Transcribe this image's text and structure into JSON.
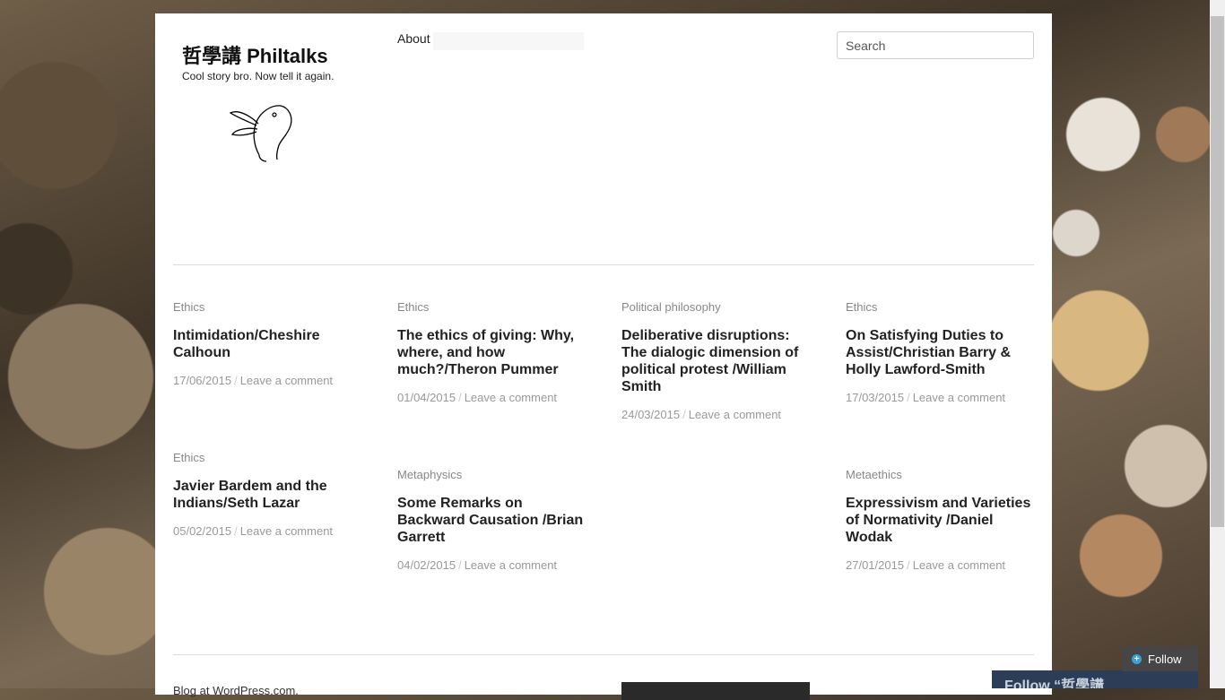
{
  "site": {
    "title": "哲學講 Philtalks",
    "description": "Cool story bro. Now tell it again.",
    "logo_icon": "rabbit-duck-icon"
  },
  "nav": {
    "about": "About"
  },
  "search": {
    "placeholder": "Search"
  },
  "posts": [
    {
      "category": "Ethics",
      "title": "Intimidation/Cheshire Calhoun",
      "date": "17/06/2015",
      "comments": "Leave a comment"
    },
    {
      "category": "Ethics",
      "title": "The ethics of giving: Why, where, and how much?/Theron Pummer",
      "date": "01/04/2015",
      "comments": "Leave a comment"
    },
    {
      "category": "Political philosophy",
      "title": "Deliberative disruptions: The dialogic dimension of political protest /William Smith",
      "date": "24/03/2015",
      "comments": "Leave a comment"
    },
    {
      "category": "Ethics",
      "title": "On Satisfying Duties to Assist/Christian Barry & Holly Lawford-Smith",
      "date": "17/03/2015",
      "comments": "Leave a comment"
    },
    {
      "category": "Ethics",
      "title": "Javier Bardem and the Indians/Seth Lazar",
      "date": "05/02/2015",
      "comments": "Leave a comment"
    },
    {
      "category": "Metaphysics",
      "title": "Some Remarks on Backward Causation /Brian Garrett",
      "date": "04/02/2015",
      "comments": "Leave a comment"
    },
    {
      "category": "Metaethics",
      "title": "Expressivism and Varieties of Normativity /Daniel Wodak",
      "date": "27/01/2015",
      "comments": "Leave a comment"
    }
  ],
  "footer": {
    "text": "Blog at WordPress.com."
  },
  "follow": {
    "button_label": "Follow",
    "icon": "plus-icon",
    "panel_text": "Follow “哲學講"
  }
}
